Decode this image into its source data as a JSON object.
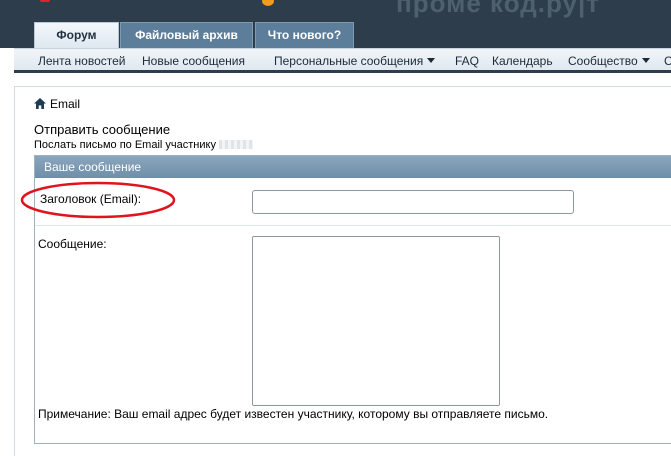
{
  "banner": {
    "text": "проме код.ру|т"
  },
  "tabs": [
    {
      "label": "Форум",
      "active": true
    },
    {
      "label": "Файловый архив",
      "active": false
    },
    {
      "label": "Что нового?",
      "active": false
    }
  ],
  "nav": {
    "items": [
      {
        "label": "Лента новостей"
      },
      {
        "label": "Новые сообщения"
      },
      {
        "label": "Персональные сообщения"
      },
      {
        "label": "FAQ"
      },
      {
        "label": "Календарь"
      },
      {
        "label": "Сообщество"
      },
      {
        "label": "С"
      }
    ]
  },
  "breadcrumb": {
    "label": "Email"
  },
  "page": {
    "title": "Отправить сообщение",
    "subtitle": "Послать письмо по Email участнику"
  },
  "form": {
    "section_title": "Ваше сообщение",
    "subject_label": "Заголовок (Email):",
    "subject_value": "",
    "message_label": "Сообщение:",
    "message_value": "",
    "note": "Примечание: Ваш email адрес будет известен участнику, которому вы отправляете письмо."
  },
  "colors": {
    "header_dark": "#2d3d4b",
    "tab_inactive": "#5c7e9a",
    "block_header": "#7b99b2",
    "annotation_red": "#e0141e"
  }
}
